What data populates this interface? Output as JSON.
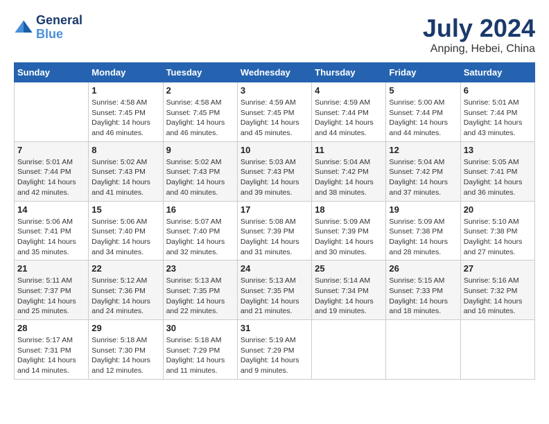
{
  "header": {
    "logo_line1": "General",
    "logo_line2": "Blue",
    "main_title": "July 2024",
    "subtitle": "Anping, Hebei, China"
  },
  "weekdays": [
    "Sunday",
    "Monday",
    "Tuesday",
    "Wednesday",
    "Thursday",
    "Friday",
    "Saturday"
  ],
  "weeks": [
    [
      {
        "day": "",
        "info": ""
      },
      {
        "day": "1",
        "info": "Sunrise: 4:58 AM\nSunset: 7:45 PM\nDaylight: 14 hours\nand 46 minutes."
      },
      {
        "day": "2",
        "info": "Sunrise: 4:58 AM\nSunset: 7:45 PM\nDaylight: 14 hours\nand 46 minutes."
      },
      {
        "day": "3",
        "info": "Sunrise: 4:59 AM\nSunset: 7:45 PM\nDaylight: 14 hours\nand 45 minutes."
      },
      {
        "day": "4",
        "info": "Sunrise: 4:59 AM\nSunset: 7:44 PM\nDaylight: 14 hours\nand 44 minutes."
      },
      {
        "day": "5",
        "info": "Sunrise: 5:00 AM\nSunset: 7:44 PM\nDaylight: 14 hours\nand 44 minutes."
      },
      {
        "day": "6",
        "info": "Sunrise: 5:01 AM\nSunset: 7:44 PM\nDaylight: 14 hours\nand 43 minutes."
      }
    ],
    [
      {
        "day": "7",
        "info": "Sunrise: 5:01 AM\nSunset: 7:44 PM\nDaylight: 14 hours\nand 42 minutes."
      },
      {
        "day": "8",
        "info": "Sunrise: 5:02 AM\nSunset: 7:43 PM\nDaylight: 14 hours\nand 41 minutes."
      },
      {
        "day": "9",
        "info": "Sunrise: 5:02 AM\nSunset: 7:43 PM\nDaylight: 14 hours\nand 40 minutes."
      },
      {
        "day": "10",
        "info": "Sunrise: 5:03 AM\nSunset: 7:43 PM\nDaylight: 14 hours\nand 39 minutes."
      },
      {
        "day": "11",
        "info": "Sunrise: 5:04 AM\nSunset: 7:42 PM\nDaylight: 14 hours\nand 38 minutes."
      },
      {
        "day": "12",
        "info": "Sunrise: 5:04 AM\nSunset: 7:42 PM\nDaylight: 14 hours\nand 37 minutes."
      },
      {
        "day": "13",
        "info": "Sunrise: 5:05 AM\nSunset: 7:41 PM\nDaylight: 14 hours\nand 36 minutes."
      }
    ],
    [
      {
        "day": "14",
        "info": "Sunrise: 5:06 AM\nSunset: 7:41 PM\nDaylight: 14 hours\nand 35 minutes."
      },
      {
        "day": "15",
        "info": "Sunrise: 5:06 AM\nSunset: 7:40 PM\nDaylight: 14 hours\nand 34 minutes."
      },
      {
        "day": "16",
        "info": "Sunrise: 5:07 AM\nSunset: 7:40 PM\nDaylight: 14 hours\nand 32 minutes."
      },
      {
        "day": "17",
        "info": "Sunrise: 5:08 AM\nSunset: 7:39 PM\nDaylight: 14 hours\nand 31 minutes."
      },
      {
        "day": "18",
        "info": "Sunrise: 5:09 AM\nSunset: 7:39 PM\nDaylight: 14 hours\nand 30 minutes."
      },
      {
        "day": "19",
        "info": "Sunrise: 5:09 AM\nSunset: 7:38 PM\nDaylight: 14 hours\nand 28 minutes."
      },
      {
        "day": "20",
        "info": "Sunrise: 5:10 AM\nSunset: 7:38 PM\nDaylight: 14 hours\nand 27 minutes."
      }
    ],
    [
      {
        "day": "21",
        "info": "Sunrise: 5:11 AM\nSunset: 7:37 PM\nDaylight: 14 hours\nand 25 minutes."
      },
      {
        "day": "22",
        "info": "Sunrise: 5:12 AM\nSunset: 7:36 PM\nDaylight: 14 hours\nand 24 minutes."
      },
      {
        "day": "23",
        "info": "Sunrise: 5:13 AM\nSunset: 7:35 PM\nDaylight: 14 hours\nand 22 minutes."
      },
      {
        "day": "24",
        "info": "Sunrise: 5:13 AM\nSunset: 7:35 PM\nDaylight: 14 hours\nand 21 minutes."
      },
      {
        "day": "25",
        "info": "Sunrise: 5:14 AM\nSunset: 7:34 PM\nDaylight: 14 hours\nand 19 minutes."
      },
      {
        "day": "26",
        "info": "Sunrise: 5:15 AM\nSunset: 7:33 PM\nDaylight: 14 hours\nand 18 minutes."
      },
      {
        "day": "27",
        "info": "Sunrise: 5:16 AM\nSunset: 7:32 PM\nDaylight: 14 hours\nand 16 minutes."
      }
    ],
    [
      {
        "day": "28",
        "info": "Sunrise: 5:17 AM\nSunset: 7:31 PM\nDaylight: 14 hours\nand 14 minutes."
      },
      {
        "day": "29",
        "info": "Sunrise: 5:18 AM\nSunset: 7:30 PM\nDaylight: 14 hours\nand 12 minutes."
      },
      {
        "day": "30",
        "info": "Sunrise: 5:18 AM\nSunset: 7:29 PM\nDaylight: 14 hours\nand 11 minutes."
      },
      {
        "day": "31",
        "info": "Sunrise: 5:19 AM\nSunset: 7:29 PM\nDaylight: 14 hours\nand 9 minutes."
      },
      {
        "day": "",
        "info": ""
      },
      {
        "day": "",
        "info": ""
      },
      {
        "day": "",
        "info": ""
      }
    ]
  ]
}
